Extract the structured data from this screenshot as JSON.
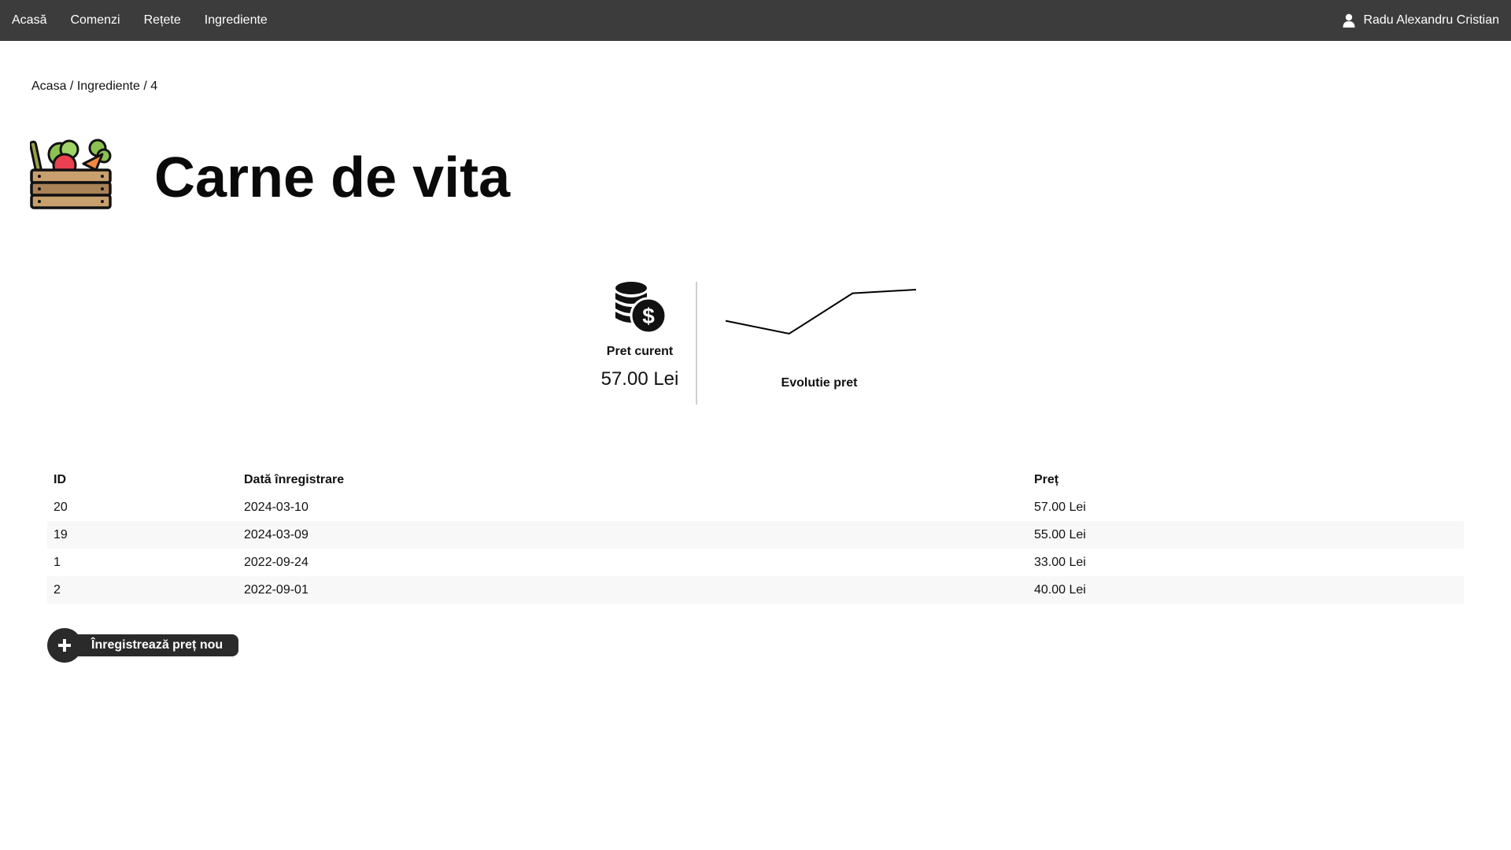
{
  "navbar": {
    "links": [
      "Acasă",
      "Comenzi",
      "Rețete",
      "Ingrediente"
    ],
    "user_name": "Radu Alexandru Cristian",
    "background": "#3c3c3c"
  },
  "breadcrumb": {
    "home": "Acasa",
    "section": "Ingrediente",
    "current": "4",
    "separator": "/"
  },
  "page": {
    "title": "Carne de vita",
    "icon": "vegetable-crate-icon"
  },
  "stats": {
    "current_price_label": "Pret curent",
    "current_price_value": "57.00 Lei",
    "coins_icon": "coins-dollar-icon",
    "evolution_label": "Evolutie pret"
  },
  "chart_data": {
    "type": "line",
    "x": [
      "2022-09-01",
      "2022-09-24",
      "2024-03-09",
      "2024-03-10"
    ],
    "values": [
      40.0,
      33.0,
      55.0,
      57.0
    ],
    "title": "",
    "xlabel": "",
    "ylabel": "",
    "color": "#000000"
  },
  "table": {
    "headers": [
      "ID",
      "Dată înregistrare",
      "Preț"
    ],
    "rows": [
      [
        "20",
        "2024-03-10",
        "57.00 Lei"
      ],
      [
        "19",
        "2024-03-09",
        "55.00 Lei"
      ],
      [
        "1",
        "2022-09-24",
        "33.00 Lei"
      ],
      [
        "2",
        "2022-09-01",
        "40.00 Lei"
      ]
    ]
  },
  "add_button": {
    "label": "Înregistrează preț nou",
    "icon": "plus-icon"
  }
}
